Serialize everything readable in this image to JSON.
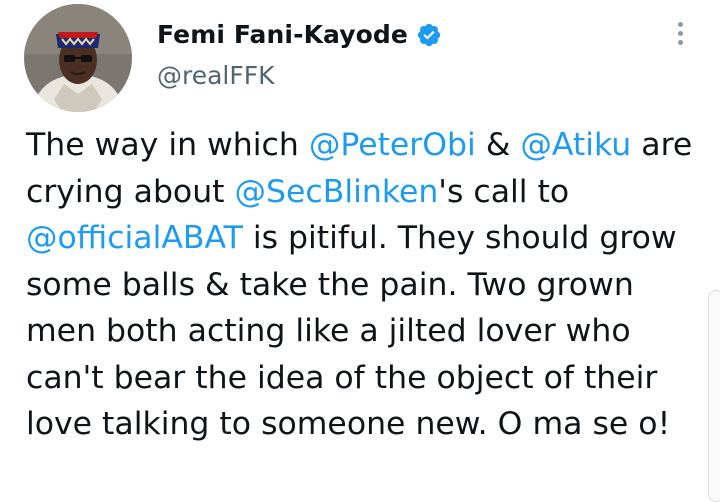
{
  "author": {
    "name": "Femi Fani-Kayode",
    "handle": "@realFFK",
    "verified_color": "#1d9bf0"
  },
  "tweet": {
    "segments": [
      {
        "text": "The way in which "
      },
      {
        "text": "@PeterObi",
        "mention": true
      },
      {
        "text": " & "
      },
      {
        "text": "@Atiku",
        "mention": true
      },
      {
        "text": " are crying about "
      },
      {
        "text": "@SecBlinken",
        "mention": true
      },
      {
        "text": "'s call to "
      },
      {
        "text": "@officialABAT",
        "mention": true
      },
      {
        "text": " is pitiful. They should grow some balls & take the pain. Two grown men both acting like a jilted lover who can't bear the idea of the object of their love talking to someone new. O ma se o!"
      }
    ]
  },
  "colors": {
    "text": "#0f1419",
    "mention": "#1d9bf0",
    "secondary": "#536471"
  },
  "icons": {
    "more": "more-vertical-icon",
    "verified": "verified-badge-icon"
  }
}
